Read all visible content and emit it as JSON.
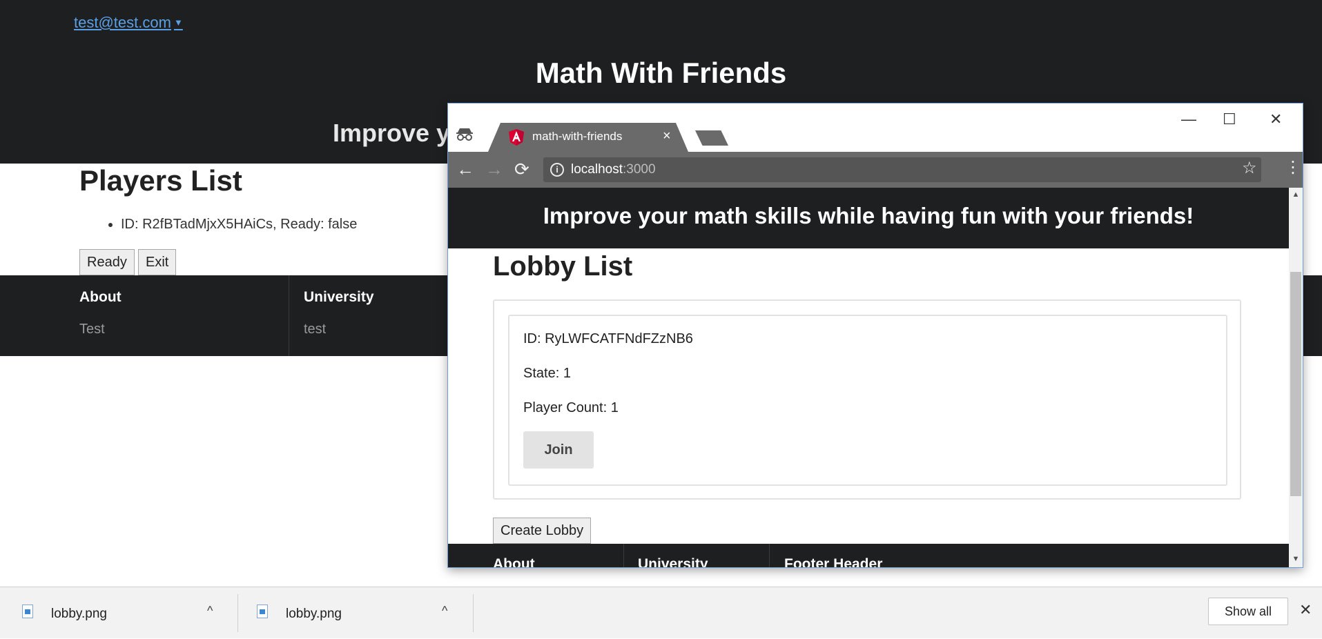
{
  "background_page": {
    "user_menu": {
      "email": "test@test.com",
      "caret": "▼"
    },
    "site_title": "Math With Friends",
    "tagline_visible": "Improve yo",
    "players_title": "Players List",
    "players": [
      "ID: R2fBTadMjxX5HAiCs, Ready: false"
    ],
    "buttons": {
      "ready": "Ready",
      "exit": "Exit"
    },
    "footer": [
      {
        "heading": "About",
        "text": "Test"
      },
      {
        "heading": "University",
        "text": "test"
      }
    ]
  },
  "browser": {
    "tab_title": "math-with-friends",
    "tab_close": "×",
    "window_controls": {
      "minimize": "—",
      "maximize": "☐",
      "close": "✕"
    },
    "nav": {
      "back": "←",
      "forward": "→",
      "reload": "⟳"
    },
    "url_host": "localhost",
    "url_port": ":3000",
    "star": "☆",
    "menu": "⋮",
    "page": {
      "tagline": "Improve your math skills while having fun with your friends!",
      "lobby_title": "Lobby List",
      "lobby": {
        "id_line": "ID: RyLWFCATFNdFZzNB6",
        "state_line": "State: 1",
        "player_count_line": "Player Count: 1",
        "join_label": "Join"
      },
      "create_lobby_label": "Create Lobby",
      "footer_headings": [
        "About",
        "University",
        "Footer Header"
      ]
    },
    "scrollbar": {
      "up": "▲",
      "down": "▼"
    }
  },
  "downloads": {
    "items": [
      {
        "filename": "lobby.png",
        "chevron": "^"
      },
      {
        "filename": "lobby.png",
        "chevron": "^"
      }
    ],
    "show_all": "Show all",
    "close": "✕"
  },
  "colors": {
    "header_bg": "#1e1f21",
    "link": "#5aa0e6",
    "browser_chrome": "#6a6a6a",
    "angular_red": "#dd0031"
  }
}
